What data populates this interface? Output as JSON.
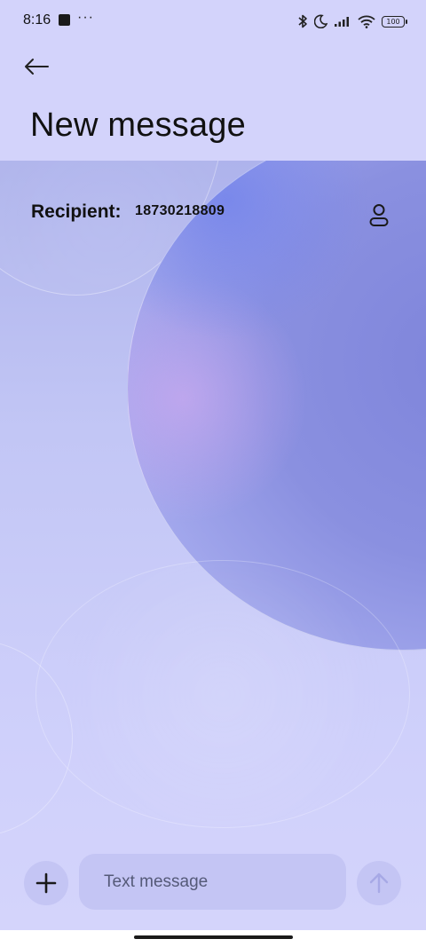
{
  "status_bar": {
    "time": "8:16",
    "notification_dots": "···",
    "battery_level": "100",
    "icons": [
      "app-notification-icon",
      "bluetooth-icon",
      "moon-icon",
      "signal-icon",
      "wifi-icon",
      "battery-icon"
    ]
  },
  "header": {
    "back_icon": "arrow-left-icon",
    "title": "New message"
  },
  "recipient": {
    "label": "Recipient:",
    "value": "18730218809",
    "contact_icon": "person-icon"
  },
  "compose": {
    "attach_icon": "plus-icon",
    "placeholder": "Text message",
    "value": "",
    "send_icon": "arrow-up-icon"
  },
  "colors": {
    "background": "#d4d4fb",
    "button_background": "#c4c5f4",
    "send_disabled": "#a7a9e6"
  }
}
